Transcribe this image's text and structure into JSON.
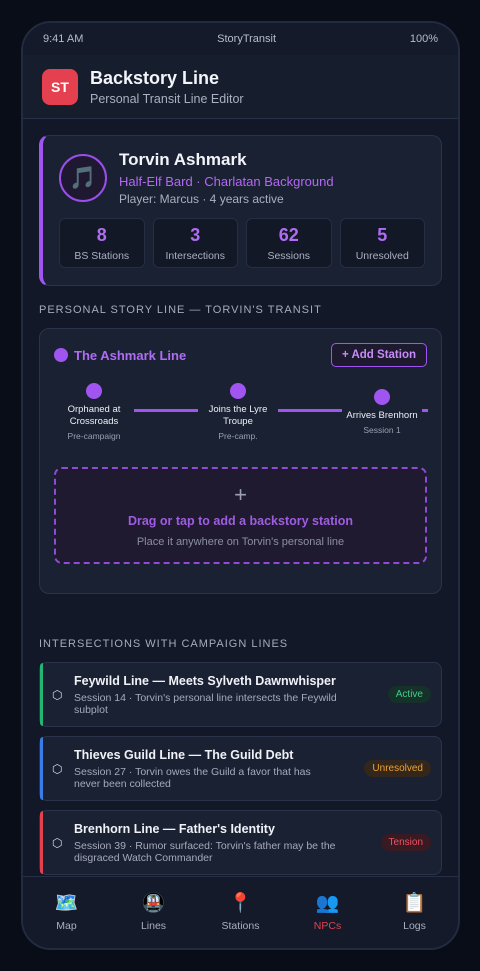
{
  "status": {
    "time": "9:41 AM",
    "app": "StoryTransit",
    "battery": "100%"
  },
  "header": {
    "logo": "ST",
    "title": "Backstory Line",
    "subtitle": "Personal Transit Line Editor"
  },
  "character": {
    "avatar_icon": "music-note-icon",
    "avatar_glyph": "🎵",
    "name": "Torvin Ashmark",
    "class": "Half-Elf Bard · Charlatan Background",
    "player": "Player: Marcus · 4 years active",
    "stats": [
      {
        "value": "8",
        "label": "BS Stations"
      },
      {
        "value": "3",
        "label": "Intersections"
      },
      {
        "value": "62",
        "label": "Sessions"
      },
      {
        "value": "5",
        "label": "Unresolved"
      }
    ]
  },
  "personal_line": {
    "section_label": "PERSONAL STORY LINE — TORVIN'S TRANSIT",
    "title": "The Ashmark Line",
    "color": "#a155f0",
    "add_button": "+ Add Station",
    "stations": [
      {
        "name_l1": "Orphaned at",
        "name_l2": "Crossroads",
        "time": "Pre-campaign"
      },
      {
        "name_l1": "Joins the Lyre",
        "name_l2": "Troupe",
        "time": "Pre-camp."
      },
      {
        "name_l1": "Arrives Brenhorn",
        "name_l2": "",
        "time": "Session 1"
      }
    ],
    "dropzone": {
      "plus": "+",
      "title": "Drag or tap to add a backstory station",
      "hint": "Place it anywhere on Torvin's personal line"
    }
  },
  "intersections": {
    "section_label": "INTERSECTIONS WITH CAMPAIGN LINES",
    "items": [
      {
        "title": "Feywild Line — Meets Sylveth Dawnwhisper",
        "desc_l1": "Session 14 · Torvin's personal line intersects the Feywild",
        "desc_l2": "subplot",
        "badge": "Active",
        "accent": "#22b573",
        "badge_fg": "#3fcf86",
        "badge_bg": "#16302a"
      },
      {
        "title": "Thieves Guild Line — The Guild Debt",
        "desc_l1": "Session 27 · Torvin owes the Guild a favor that has",
        "desc_l2": "never been collected",
        "badge": "Unresolved",
        "accent": "#3b7de8",
        "badge_fg": "#f0a232",
        "badge_bg": "#33261a"
      },
      {
        "title": "Brenhorn Line — Father's Identity",
        "desc_l1": "Session 39 · Rumor surfaced: Torvin's father may be the",
        "desc_l2": "disgraced Watch Commander",
        "badge": "Tension",
        "accent": "#e5404f",
        "badge_fg": "#ef5060",
        "badge_bg": "#3a1a22"
      }
    ]
  },
  "tabs": [
    {
      "label": "Map",
      "icon": "map-icon",
      "glyph": "🗺️"
    },
    {
      "label": "Lines",
      "icon": "train-icon",
      "glyph": "🚇"
    },
    {
      "label": "Stations",
      "icon": "pin-icon",
      "glyph": "📍"
    },
    {
      "label": "NPCs",
      "icon": "people-icon",
      "glyph": "👥"
    },
    {
      "label": "Logs",
      "icon": "clipboard-icon",
      "glyph": "📋"
    }
  ],
  "active_tab": "NPCs"
}
